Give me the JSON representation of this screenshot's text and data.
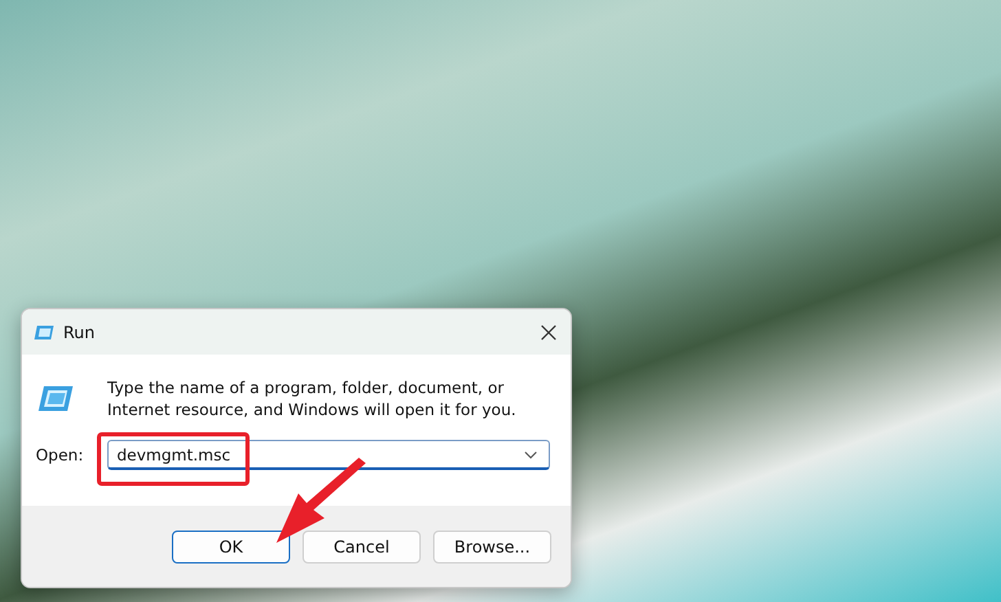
{
  "window": {
    "title": "Run"
  },
  "message": "Type the name of a program, folder, document, or Internet resource, and Windows will open it for you.",
  "open_field": {
    "label": "Open:",
    "value": "devmgmt.msc"
  },
  "buttons": [
    {
      "label": "OK",
      "selected": true
    },
    {
      "label": "Cancel",
      "selected": false
    },
    {
      "label": "Browse...",
      "selected": false
    }
  ]
}
